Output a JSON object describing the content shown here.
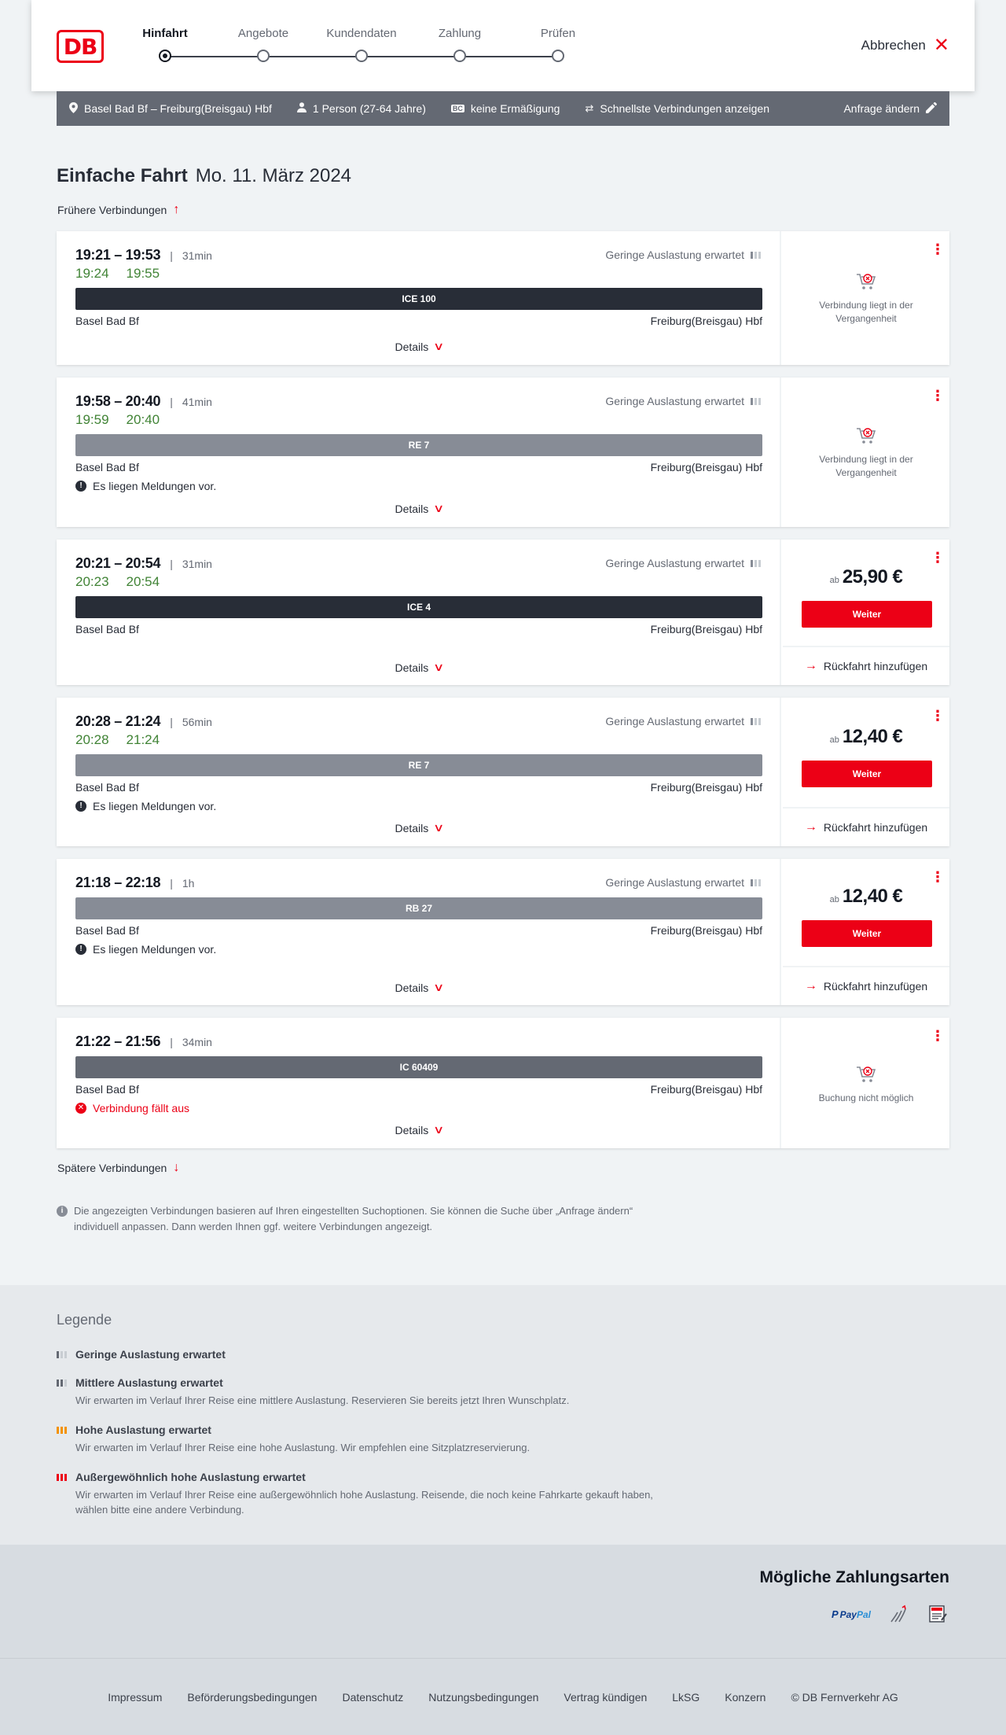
{
  "header": {
    "logo_text": "DB",
    "steps": [
      "Hinfahrt",
      "Angebote",
      "Kundendaten",
      "Zahlung",
      "Prüfen"
    ],
    "active_step": "Hinfahrt",
    "cancel_label": "Abbrechen"
  },
  "summary": {
    "route": "Basel Bad Bf – Freiburg(Breisgau) Hbf",
    "travellers": "1 Person (27-64 Jahre)",
    "discount_badge": "BC",
    "discount": "keine Ermäßigung",
    "fastest": "Schnellste Verbindungen anzeigen",
    "change_label": "Anfrage ändern"
  },
  "page": {
    "trip_type": "Einfache Fahrt",
    "date": "Mo. 11. März 2024",
    "earlier_label": "Frühere Verbindungen",
    "later_label": "Spätere Verbindungen",
    "note": "Die angezeigten Verbindungen basieren auf Ihren eingestellten Suchoptionen. Sie können die Suche über „Anfrage ändern“ individuell anpassen. Dann werden Ihnen ggf. weitere Verbindungen angezeigt."
  },
  "connections": [
    {
      "times": "19:21 – 19:53",
      "duration": "31min",
      "rt_dep": "19:24",
      "rt_arr": "19:55",
      "load": "Geringe Auslastung erwartet",
      "train": "ICE 100",
      "from": "Basel Bad Bf",
      "to": "Freiburg(Breisgau) Hbf",
      "message": "",
      "details": "Details",
      "status": "Verbindung liegt in der Vergangenheit"
    },
    {
      "times": "19:58 – 20:40",
      "duration": "41min",
      "rt_dep": "19:59",
      "rt_arr": "20:40",
      "load": "Geringe Auslastung erwartet",
      "train": "RE 7",
      "from": "Basel Bad Bf",
      "to": "Freiburg(Breisgau) Hbf",
      "message": "Es liegen Meldungen vor.",
      "details": "Details",
      "status": "Verbindung liegt in der Vergangenheit"
    },
    {
      "times": "20:21 – 20:54",
      "duration": "31min",
      "rt_dep": "20:23",
      "rt_arr": "20:54",
      "load": "Geringe Auslastung erwartet",
      "train": "ICE 4",
      "from": "Basel Bad Bf",
      "to": "Freiburg(Breisgau) Hbf",
      "message": "",
      "details": "Details",
      "price_prefix": "ab",
      "price": "25,90 €",
      "cta": "Weiter",
      "return": "Rückfahrt hinzufügen"
    },
    {
      "times": "20:28 – 21:24",
      "duration": "56min",
      "rt_dep": "20:28",
      "rt_arr": "21:24",
      "load": "Geringe Auslastung erwartet",
      "train": "RE 7",
      "from": "Basel Bad Bf",
      "to": "Freiburg(Breisgau) Hbf",
      "message": "Es liegen Meldungen vor.",
      "details": "Details",
      "price_prefix": "ab",
      "price": "12,40 €",
      "cta": "Weiter",
      "return": "Rückfahrt hinzufügen"
    },
    {
      "times": "21:18 – 22:18",
      "duration": "1h",
      "load": "Geringe Auslastung erwartet",
      "train": "RB 27",
      "from": "Basel Bad Bf",
      "to": "Freiburg(Breisgau) Hbf",
      "message": "Es liegen Meldungen vor.",
      "details": "Details",
      "price_prefix": "ab",
      "price": "12,40 €",
      "cta": "Weiter",
      "return": "Rückfahrt hinzufügen"
    },
    {
      "times": "21:22 – 21:56",
      "duration": "34min",
      "train": "IC 60409",
      "from": "Basel Bad Bf",
      "to": "Freiburg(Breisgau) Hbf",
      "message": "Verbindung fällt aus",
      "details": "Details",
      "status": "Buchung nicht möglich"
    }
  ],
  "legend": {
    "title": "Legende",
    "items": [
      {
        "title": "Geringe Auslastung erwartet",
        "desc": ""
      },
      {
        "title": "Mittlere Auslastung erwartet",
        "desc": "Wir erwarten im Verlauf Ihrer Reise eine mittlere Auslastung. Reservieren Sie bereits jetzt Ihren Wunschplatz."
      },
      {
        "title": "Hohe Auslastung erwartet",
        "desc": "Wir erwarten im Verlauf Ihrer Reise eine hohe Auslastung. Wir empfehlen eine Sitzplatzreservierung."
      },
      {
        "title": "Außergewöhnlich hohe Auslastung erwartet",
        "desc": "Wir erwarten im Verlauf Ihrer Reise eine außergewöhnlich hohe Auslastung. Reisende, die noch keine Fahrkarte gekauft haben, wählen bitte eine andere Verbindung."
      }
    ]
  },
  "payment": {
    "title": "Mögliche Zahlungsarten",
    "paypal_a": "Pay",
    "paypal_b": "Pal"
  },
  "footer": {
    "links": [
      "Impressum",
      "Beförderungsbedingungen",
      "Datenschutz",
      "Nutzungsbedingungen",
      "Vertrag kündigen",
      "LkSG",
      "Konzern",
      "© DB Fernverkehr AG"
    ]
  }
}
